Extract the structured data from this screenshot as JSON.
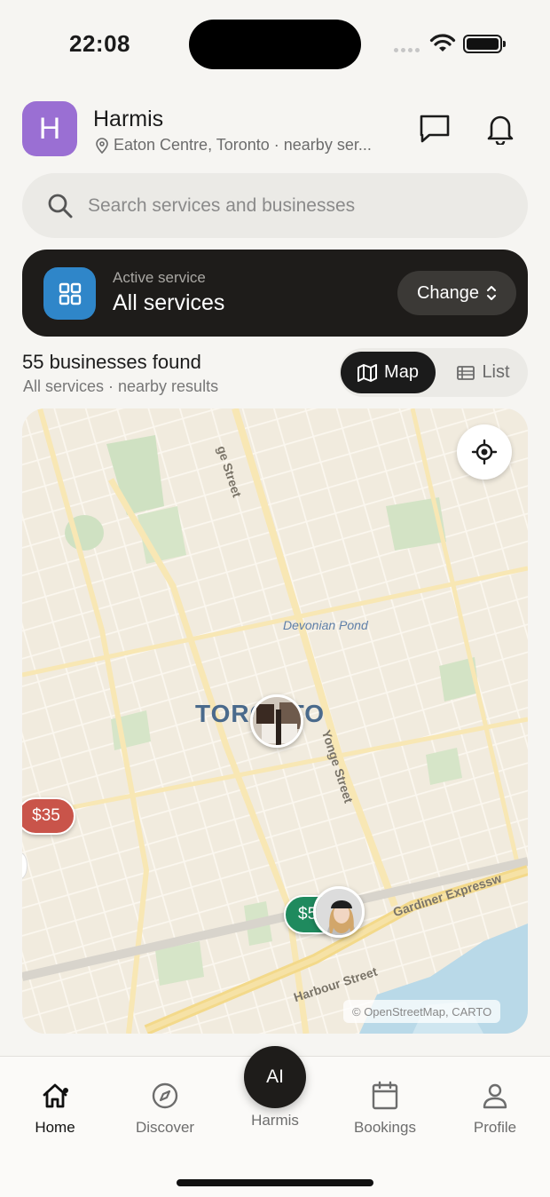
{
  "status_bar": {
    "time": "22:08"
  },
  "header": {
    "avatar_letter": "H",
    "app_name": "Harmis",
    "location": "Eaton Centre, Toronto · nearby ser...",
    "icons": [
      "chat-icon",
      "bell-icon"
    ]
  },
  "search": {
    "placeholder": "Search services and businesses"
  },
  "active_service": {
    "label": "Active service",
    "value": "All services",
    "change_label": "Change"
  },
  "results": {
    "count_text": "55 businesses found",
    "subtitle": "All services · nearby results",
    "view_toggle": {
      "map_label": "Map",
      "list_label": "List",
      "selected": "Map"
    }
  },
  "map": {
    "city_label": "TORONTO",
    "pond_label": "Devonian Pond",
    "streets": {
      "yonge_top": "ge Street",
      "yonge": "Yonge Street",
      "gardiner": "Gardiner Expressw",
      "harbour": "Harbour Street"
    },
    "pins": {
      "red_price": "$35",
      "green_price": "$5"
    },
    "attribution": "© OpenStreetMap, CARTO",
    "colors": {
      "red_pin": "#c9544a",
      "green_pin": "#1f8a5e",
      "expressway": "#f3d98a"
    }
  },
  "tabbar": {
    "home": "Home",
    "discover": "Discover",
    "ai_button": "AI",
    "ai_label": "Harmis",
    "bookings": "Bookings",
    "profile": "Profile",
    "active": "Home"
  }
}
